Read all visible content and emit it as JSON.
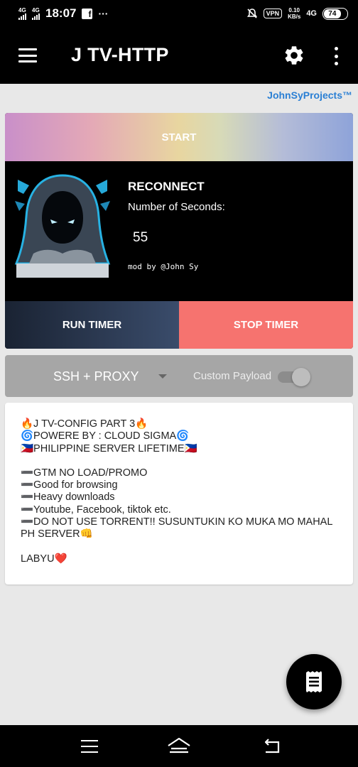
{
  "status_bar": {
    "sim1_type": "4G",
    "sim2_type": "4G",
    "time": "18:07",
    "more": "···",
    "vpn": "VPN",
    "speed_value": "0.10",
    "speed_unit": "KB/s",
    "network": "4G",
    "battery": "74",
    "icons": [
      "signal-icon",
      "facebook-icon",
      "mute-icon",
      "vpn-icon",
      "battery-icon"
    ]
  },
  "app_bar": {
    "title": "J TV-HTTP",
    "icons": [
      "hamburger-menu-icon",
      "gear-icon",
      "more-vert-icon"
    ]
  },
  "credit": "JohnSyProjects™",
  "main_card": {
    "start_label": "START",
    "reconnect_title": "RECONNECT",
    "seconds_label": "Number of Seconds:",
    "seconds_value": "55",
    "mod_credit": "mod by @John Sy",
    "run_timer_label": "RUN TIMER",
    "stop_timer_label": "STOP TIMER"
  },
  "mode_bar": {
    "selected_mode": "SSH + PROXY",
    "custom_payload_label": "Custom Payload",
    "custom_payload_enabled": false
  },
  "notes": {
    "line1": "🔥J TV-CONFIG PART 3🔥",
    "line2": "🌀POWERE BY : CLOUD SIGMA🌀",
    "line3": "🇵🇭PHILIPPINE SERVER LIFETIME🇵🇭",
    "line4": "➖GTM NO LOAD/PROMO",
    "line5": "➖Good for browsing",
    "line6": "➖Heavy downloads",
    "line7": "➖Youtube, Facebook, tiktok etc.",
    "line8": "➖DO NOT USE TORRENT!! SUSUNTUKIN KO MUKA MO MAHAL PH SERVER👊",
    "line9": "LABYU❤️"
  },
  "colors": {
    "app_bar_bg": "#000000",
    "credit_blue": "#2a7fd4",
    "stop_red": "#f6736f",
    "run_navy": "#2c3a52",
    "mode_gray": "#a6a6a6"
  }
}
